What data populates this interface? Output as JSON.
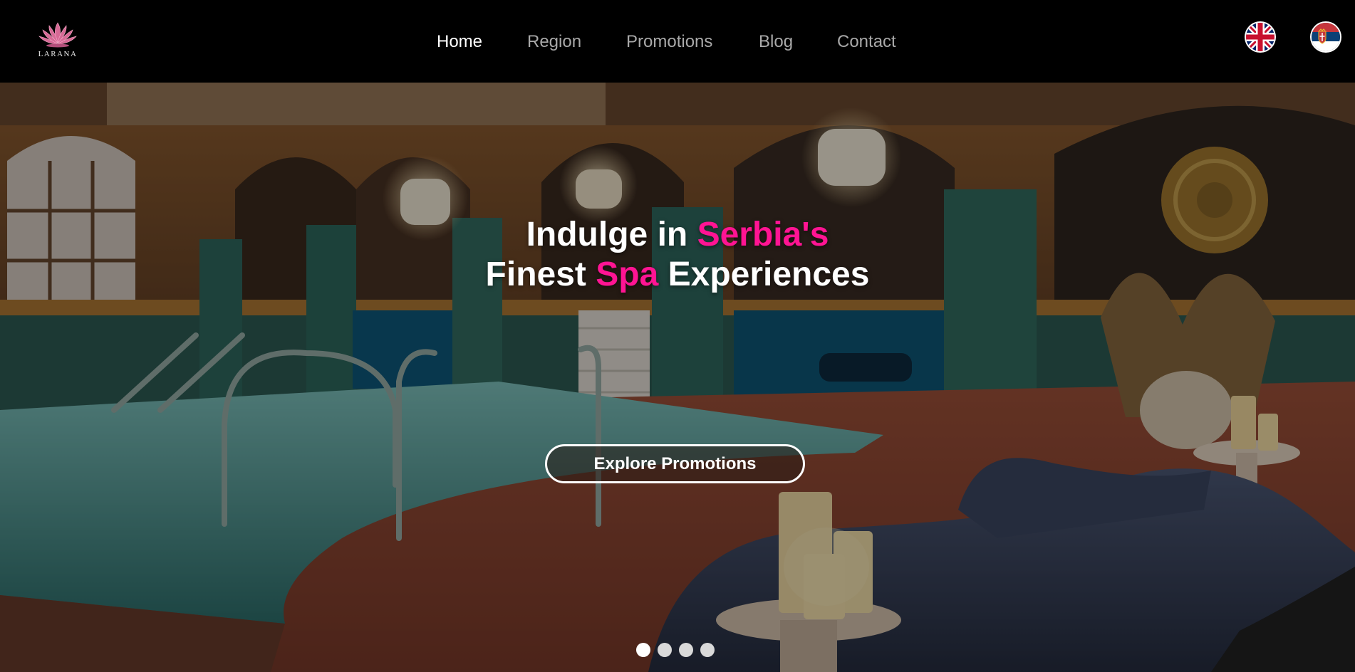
{
  "brand": {
    "name": "LARANA",
    "accent_color": "#ff1493",
    "logo_icon": "lotus-icon"
  },
  "nav": {
    "items": [
      {
        "label": "Home",
        "active": true
      },
      {
        "label": "Region",
        "active": false
      },
      {
        "label": "Promotions",
        "active": false
      },
      {
        "label": "Blog",
        "active": false
      },
      {
        "label": "Contact",
        "active": false
      }
    ]
  },
  "languages": [
    {
      "icon": "uk-flag-icon"
    },
    {
      "icon": "serbia-flag-icon"
    }
  ],
  "hero": {
    "headline_line1_part1": "Indulge in ",
    "headline_line1_part2": "Serbia's",
    "headline_line2_part1": "Finest ",
    "headline_line2_part2": "Spa",
    "headline_line2_part3": " Experiences",
    "cta_label": "Explore Promotions",
    "slides_total": 4,
    "active_slide": 1
  }
}
